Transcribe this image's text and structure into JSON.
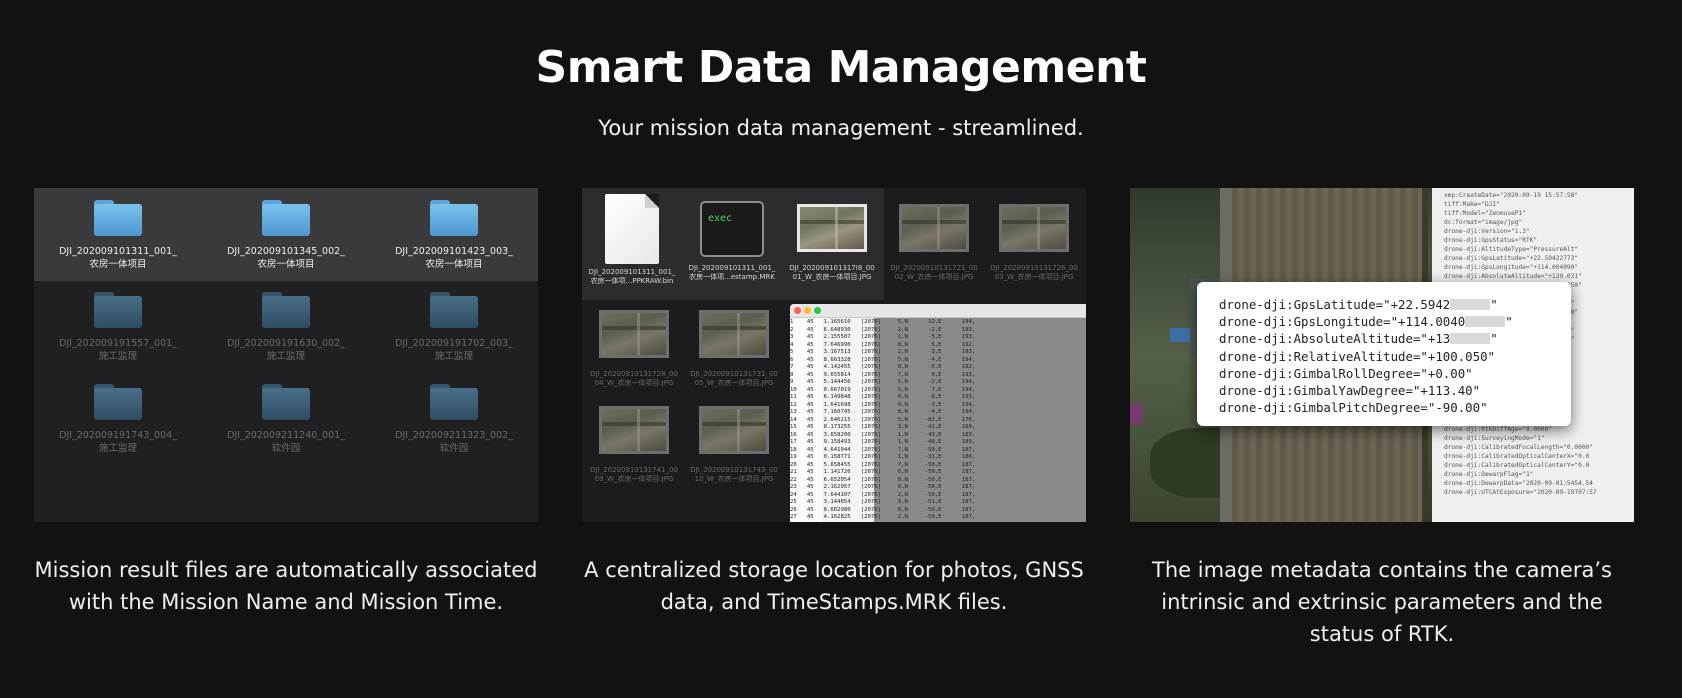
{
  "header": {
    "title": "Smart Data Management",
    "subtitle": "Your mission data management - streamlined."
  },
  "folders_panel": {
    "folders": [
      {
        "line1": "DJI_202009101311_001_",
        "line2": "农房一体项目",
        "state": "selected"
      },
      {
        "line1": "DJI_202009101345_002_",
        "line2": "农房一体项目",
        "state": "selected"
      },
      {
        "line1": "DJI_202009101423_003_",
        "line2": "农房一体项目",
        "state": "selected"
      },
      {
        "line1": "DJI_202009191557_001_",
        "line2": "施工监理",
        "state": "dim"
      },
      {
        "line1": "DJI_202009191630_002_",
        "line2": "施工监理",
        "state": "dim"
      },
      {
        "line1": "DJI_202009191702_003_",
        "line2": "施工监理",
        "state": "dim"
      },
      {
        "line1": "DJI_202009191743_004_",
        "line2": "施工监理",
        "state": "dim"
      },
      {
        "line1": "DJI_202009211240_001_",
        "line2": "软件园",
        "state": "dim"
      },
      {
        "line1": "DJI_202009211323_002_",
        "line2": "软件园",
        "state": "dim"
      }
    ]
  },
  "files_panel": {
    "top_files": [
      {
        "icon": "document-icon",
        "line1": "DJI_202009101311_001_",
        "line2": "农房一体项...PPKRAW.bin"
      },
      {
        "icon": "exec-icon",
        "icon_text": "exec",
        "line1": "DJI_202009101311_001_",
        "line2": "农房一体项...estamp.MRK"
      },
      {
        "icon": "image-thumbnail",
        "line1": "DJI_202009101317I8_00",
        "line2": "01_W_农房一体项目.JPG"
      },
      {
        "icon": "image-thumbnail",
        "line1": "DJI_20200910131721_00",
        "line2": "02_W_农房一体项目.JPG"
      },
      {
        "icon": "image-thumbnail",
        "line1": "DJI_20200910131726_00",
        "line2": "03_W_农房一体项目.JPG"
      }
    ],
    "lower_files": [
      {
        "line1": "DJI_20200910131728_00",
        "line2": "04_W_农房一体项目.JPG"
      },
      {
        "line1": "DJI_20200910131731_00",
        "line2": "05_W_农房一体项目.JPG"
      },
      {
        "line1": "DJI_20200910131741_00",
        "line2": "09_W_农房一体项目.JPG"
      },
      {
        "line1": "DJI_20200910131743_00",
        "line2": "10_W_农房一体项目.JPG"
      }
    ],
    "mrk_lines": [
      "1    45   1.165610   [2076]     5,N      12,E      194,",
      "2    45   6.648930   [2076]     2,N      -2,E      193,",
      "3    45   2.155507   [2076]     1,N      -5,E      193,",
      "4    45   7.646990   [2076]     8,N       5,E      192,",
      "5    45   3.167513   [2076]     2,N      -3,E      193,",
      "6    45   8.663328   [2076]     5,N      -4,E      194,",
      "7    45   4.142455   [2076]     8,N      -5,E      192,",
      "8    45   9.655814   [2076]     7,N       0,E      193,",
      "9    45   5.144456   [2076]     5,N      -2,E      194,",
      "10   45   0.667019   [2076]     5,N       7,E      194,",
      "11   45   6.149848   [2076]     0,N      -8,E      193,",
      "12   45   1.641698   [2076]     9,N      -3,E      194,",
      "13   45   7.160745   [2076]     8,N      -4,E      194,",
      "14   45   2.646215   [2076]     5,N     -83,E      176,",
      "15   45   8.173255   [2076]     3,N     -42,E      189,",
      "16   45   3.658200   [2076]     1,N     -43,E      189,",
      "17   45   9.158493   [2076]     1,N     -48,E      189,",
      "18   45   4.641944   [2076]     7,N     -50,E      187,",
      "19   45   0.158771   [2076]     1,N     -31,E      186,",
      "20   45   5.658455   [2076]     7,N     -50,E      187,",
      "21   45   1.141726   [2076]     6,N     -50,E      187,",
      "22   45   6.652054   [2076]     8,N     -50,E      187,",
      "23   45   2.162957   [2076]     9,N     -50,E      187,",
      "24   45   7.644107   [2076]     2,N     -50,E      187,",
      "25   45   3.144054   [2076]     3,N     -51,E      187,",
      "26   45   8.662980   [2076]     8,N     -50,E      187,",
      "27   45   4.162825   [2076]     2,N     -50,E      187,"
    ]
  },
  "metadata_panel": {
    "card_rows": [
      {
        "text": "drone-dji:GpsLatitude=\"+22.5942",
        "suffix": "\"",
        "redacted": true
      },
      {
        "text": "drone-dji:GpsLongitude=\"+114.0040",
        "suffix": "\"",
        "redacted": true
      },
      {
        "text": "drone-dji:AbsoluteAltitude=\"+13",
        "suffix": "\"",
        "redacted": true
      },
      {
        "text": "drone-dji:RelativeAltitude=\"+100.050\"",
        "suffix": "",
        "redacted": false
      },
      {
        "text": "drone-dji:GimbalRollDegree=\"+0.00\"",
        "suffix": "",
        "redacted": false
      },
      {
        "text": "drone-dji:GimbalYawDegree=\"+113.40\"",
        "suffix": "",
        "redacted": false
      },
      {
        "text": "drone-dji:GimbalPitchDegree=\"-90.00\"",
        "suffix": "",
        "redacted": false
      }
    ],
    "side_lines": [
      "xmp:CreateDate=\"2020-09-19 15:57:58\"",
      "tiff:Make=\"DJI\"",
      "tiff:Model=\"ZenmuseP1\"",
      "dc:format=\"image/jpg\"",
      "drone-dji:Version=\"1.3\"",
      "drone-dji:GpsStatus=\"RTK\"",
      "drone-dji:AltitudeType=\"PressureAlt\"",
      "drone-dji:GpsLatitude=\"+22.59422773\"",
      "drone-dji:GpsLongitude=\"+114.004090\"",
      "drone-dji:AbsoluteAltitude=\"+139.031\"",
      "drone-dji:RelativeAltitude=\"+100.050\"",
      "drone-dji:GimbalRollDegree=\"+0.00\"",
      "drone-dji:GimbalYawDegree=\"+113.40\"",
      "drone-dji:GimbalPitchDegree=\"-90.00\"",
      "drone-dji:FlightRollDegree=\"+1.60\"",
      "drone-dji:FlightYawDegree=\"+115.60\"",
      "drone-dji:FlightPitchDegree=\"+3.60\"",
      "drone-dji:FlightXSpeed=\"+0.00\"",
      "drone-dji:FlightYSpeed=\"+0.00\"",
      "drone-dji:FlightZSpeed=\"+0.00\"",
      "drone-dji:CamReverse=\"0\"",
      "drone-dji:GimbalReverse=\"0\"",
      "drone-dji:RtkFlag=\"50\"",
      "drone-dji:RtkStdLon=\"0.01028\"",
      "drone-dji:RtkStdLat=\"0.01015\"",
      "drone-dji:RtkStdHgt=\"0.03858\"",
      "drone-dji:RtkDiffAge=\"0.0000\"",
      "drone-dji:SurveyingMode=\"1\"",
      "drone-dji:CalibratedFocalLength=\"0.0000\"",
      "drone-dji:CalibratedOpticalCenterX=\"0.0",
      "drone-dji:CalibratedOpticalCenterY=\"0.0",
      "drone-dji:DewarpFlag=\"1\"",
      "drone-dji:DewarpData=\"2020-09-01;5454.54",
      "drone-dji:UTCAtExposure=\"2020-09-19T07:57"
    ]
  },
  "captions": {
    "left": "Mission result files are automatically associated with the Mission Name and Mission Time.",
    "middle": "A centralized storage location for photos, GNSS data, and TimeStamps.MRK files.",
    "right": "The image metadata contains the camera’s intrinsic and extrinsic parameters and the status of RTK."
  },
  "colors": {
    "background": "#121212",
    "folder_blue": "#6cb8ea",
    "window_close": "#ff5f57",
    "window_min": "#febc2e",
    "window_max": "#28c840"
  }
}
